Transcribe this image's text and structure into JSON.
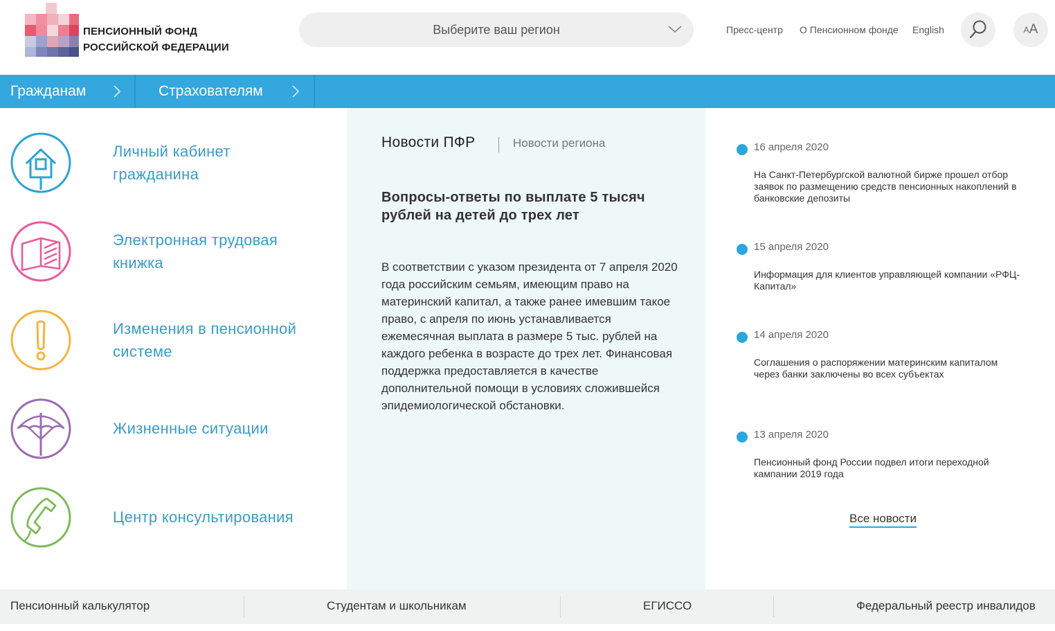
{
  "header": {
    "logo_line1": "ПЕНСИОННЫЙ ФОНД",
    "logo_line2": "РОССИЙСКОЙ ФЕДЕРАЦИИ",
    "region_placeholder": "Выберите ваш регион",
    "links": {
      "press": "Пресс-центр",
      "about": "О Пенсионном фонде",
      "english": "English"
    },
    "font_size_small": "A",
    "font_size_big": "A"
  },
  "nav": {
    "citizens": "Гражданам",
    "insurers": "Страхователям"
  },
  "services": [
    {
      "label": "Личный кабинет гражданина",
      "icon": "house-icon",
      "color": "#2ea3d6"
    },
    {
      "label": "Электронная трудовая книжка",
      "icon": "book-icon",
      "color": "#e85a9b"
    },
    {
      "label": "Изменения в пенсионной системе",
      "icon": "exclamation-icon",
      "color": "#f2b63c"
    },
    {
      "label": "Жизненные ситуации",
      "icon": "umbrella-icon",
      "color": "#9a6bb0"
    },
    {
      "label": "Центр консультирования",
      "icon": "phone-icon",
      "color": "#7dbb57"
    }
  ],
  "middle": {
    "tab_main": "Новости ПФР",
    "tab_region": "Новости региона",
    "article_title": "Вопросы-ответы по выплате 5 тысяч рублей на детей до трех лет",
    "article_body": "В соответствии с указом президента от 7 апреля 2020 года российским семьям, имеющим право на материнский капитал, а также ранее имевшим такое право, с апреля по июнь устанавливается ежемесячная выплата в размере 5 тыс. рублей на каждого ребенка в возрасте до трех лет. Финансовая поддержка предоставляется в качестве дополнительной помощи в условиях сложившейся эпидемиологической обстановки."
  },
  "news": [
    {
      "date": "16 апреля 2020",
      "text": "На Санкт-Петербургской валютной бирже прошел отбор заявок по размещению средств пенсионных накоплений в банковские депозиты"
    },
    {
      "date": "15 апреля 2020",
      "text": "Информация для клиентов управляющей компании «РФЦ-Капитал»"
    },
    {
      "date": "14 апреля 2020",
      "text": "Соглашения о распоряжении материнским капиталом через банки заключены во всех субъектах"
    },
    {
      "date": "13 апреля 2020",
      "text": "Пенсионный фонд России подвел итоги переходной кампании 2019 года"
    }
  ],
  "all_news": "Все новости",
  "footer": {
    "calculator": "Пенсионный калькулятор",
    "students": "Студентам и школьникам",
    "egisso": "ЕГИССО",
    "registry": "Федеральный реестр инвалидов"
  },
  "colors": {
    "nav_blue": "#33a7de",
    "middle_bg": "#eef8f8",
    "accent": "#2ca6de"
  }
}
